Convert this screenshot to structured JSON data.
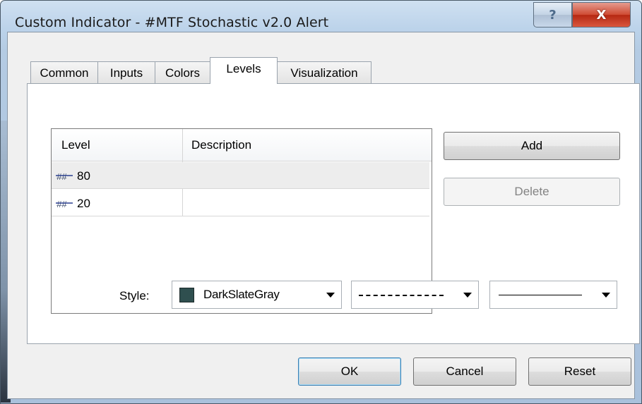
{
  "window": {
    "title": "Custom Indicator - #MTF Stochastic v2.0 Alert"
  },
  "caption_buttons": {
    "help": "?",
    "close": "X"
  },
  "tabs": [
    {
      "label": "Common",
      "active": false
    },
    {
      "label": "Inputs",
      "active": false
    },
    {
      "label": "Colors",
      "active": false
    },
    {
      "label": "Levels",
      "active": true
    },
    {
      "label": "Visualization",
      "active": false
    }
  ],
  "levels_table": {
    "columns": [
      "Level",
      "Description"
    ],
    "rows": [
      {
        "level": "80",
        "description": "",
        "selected": true
      },
      {
        "level": "20",
        "description": "",
        "selected": false
      }
    ]
  },
  "side_buttons": {
    "add": "Add",
    "delete": "Delete"
  },
  "style": {
    "label": "Style:",
    "color_name": "DarkSlateGray",
    "color_hex": "#2f4f4f",
    "line_style": "dashed",
    "line_width": "solid-thin"
  },
  "footer_buttons": {
    "ok": "OK",
    "cancel": "Cancel",
    "reset": "Reset"
  },
  "icons": {
    "level_icon": "strikethrough-level-icon"
  }
}
